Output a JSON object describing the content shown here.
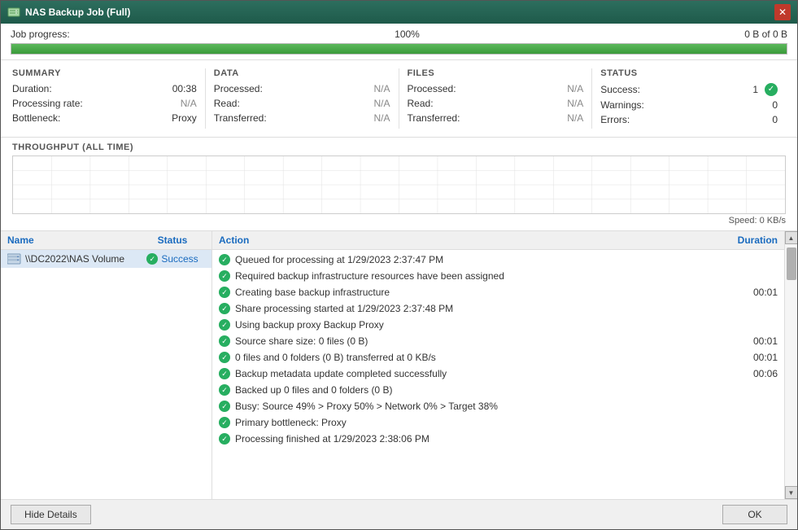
{
  "window": {
    "title": "NAS Backup Job (Full)",
    "close_label": "✕"
  },
  "progress": {
    "label": "Job progress:",
    "percent": "100%",
    "size_label": "0 B of 0 B",
    "fill_percent": 100
  },
  "summary": {
    "heading": "SUMMARY",
    "rows": [
      {
        "key": "Duration:",
        "value": "00:38",
        "dim": false
      },
      {
        "key": "Processing rate:",
        "value": "N/A",
        "dim": true
      },
      {
        "key": "Bottleneck:",
        "value": "Proxy",
        "dim": false
      }
    ]
  },
  "data": {
    "heading": "DATA",
    "rows": [
      {
        "key": "Processed:",
        "value": "N/A"
      },
      {
        "key": "Read:",
        "value": "N/A"
      },
      {
        "key": "Transferred:",
        "value": "N/A"
      }
    ]
  },
  "files": {
    "heading": "FILES",
    "rows": [
      {
        "key": "Processed:",
        "value": "N/A"
      },
      {
        "key": "Read:",
        "value": "N/A"
      },
      {
        "key": "Transferred:",
        "value": "N/A"
      }
    ]
  },
  "status": {
    "heading": "STATUS",
    "rows": [
      {
        "key": "Success:",
        "value": "1",
        "has_icon": true
      },
      {
        "key": "Warnings:",
        "value": "0",
        "has_icon": false
      },
      {
        "key": "Errors:",
        "value": "0",
        "has_icon": false
      }
    ]
  },
  "throughput": {
    "heading": "THROUGHPUT (ALL TIME)",
    "speed_label": "Speed: 0 KB/s"
  },
  "left_panel": {
    "col_name": "Name",
    "col_status": "Status",
    "items": [
      {
        "name": "\\\\DC2022\\NAS Volume",
        "status": "Success"
      }
    ]
  },
  "right_panel": {
    "col_action": "Action",
    "col_duration": "Duration",
    "log_items": [
      {
        "text": "Queued for processing at 1/29/2023 2:37:47 PM",
        "duration": ""
      },
      {
        "text": "Required backup infrastructure resources have been assigned",
        "duration": ""
      },
      {
        "text": "Creating base backup infrastructure",
        "duration": "00:01"
      },
      {
        "text": "Share processing started at 1/29/2023 2:37:48 PM",
        "duration": ""
      },
      {
        "text": "Using backup proxy Backup Proxy",
        "duration": ""
      },
      {
        "text": "Source share size: 0 files (0 B)",
        "duration": "00:01"
      },
      {
        "text": "0 files and 0 folders (0 B) transferred at 0 KB/s",
        "duration": "00:01"
      },
      {
        "text": "Backup metadata update completed successfully",
        "duration": "00:06"
      },
      {
        "text": "Backed up 0 files and 0 folders (0 B)",
        "duration": ""
      },
      {
        "text": "Busy: Source 49% > Proxy 50% > Network 0% > Target 38%",
        "duration": ""
      },
      {
        "text": "Primary bottleneck: Proxy",
        "duration": ""
      },
      {
        "text": "Processing finished at 1/29/2023 2:38:06 PM",
        "duration": ""
      }
    ]
  },
  "footer": {
    "hide_details_label": "Hide Details",
    "ok_label": "OK"
  }
}
